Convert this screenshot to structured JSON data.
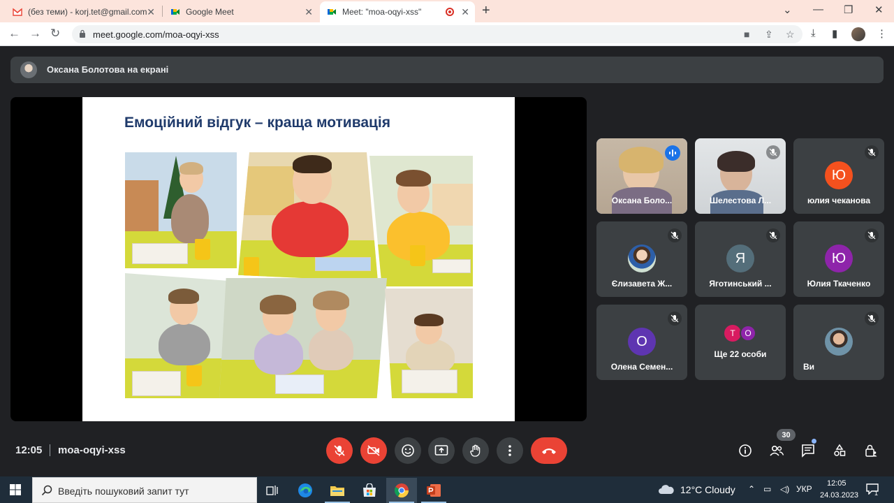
{
  "browser": {
    "tabs": [
      {
        "title": "(без теми) - korj.tet@gmail.com",
        "icon": "gmail-icon"
      },
      {
        "title": "Google Meet",
        "icon": "meet-icon"
      },
      {
        "title": "Meet: \"moa-oqyi-xss\"",
        "icon": "meet-icon",
        "recording": true
      }
    ],
    "url": "meet.google.com/moa-oqyi-xss"
  },
  "meet": {
    "presenting_banner": "Оксана Болотова на екрані",
    "slide": {
      "title": "Емоційний відгук – краща мотивація"
    },
    "participants": [
      {
        "name": "Оксана Боло...",
        "muted": false,
        "speaking": true,
        "type": "video"
      },
      {
        "name": "Шелестова Л...",
        "muted": true,
        "type": "video"
      },
      {
        "name": "юлия чеканова",
        "muted": true,
        "type": "letter",
        "letter": "Ю",
        "color": "#f4511e"
      },
      {
        "name": "Єлизавета Ж...",
        "muted": true,
        "type": "photo"
      },
      {
        "name": "Яготинський ...",
        "muted": true,
        "type": "letter",
        "letter": "Я",
        "color": "#546e7a"
      },
      {
        "name": "Юлия Ткаченко",
        "muted": true,
        "type": "letter",
        "letter": "Ю",
        "color": "#8e24aa"
      },
      {
        "name": "Олена Семен...",
        "muted": true,
        "type": "letter",
        "letter": "О",
        "color": "#5e35b1"
      },
      {
        "name": "Ще 22 особи",
        "type": "more",
        "mini": [
          "Т",
          "О"
        ],
        "mini_colors": [
          "#d81b60",
          "#8e24aa"
        ]
      },
      {
        "name": "Ви",
        "muted": true,
        "type": "photo"
      }
    ],
    "time": "12:05",
    "meeting_code": "moa-oqyi-xss",
    "participant_count": "30"
  },
  "taskbar": {
    "search_placeholder": "Введіть пошуковий запит тут",
    "weather": "12°C  Cloudy",
    "language": "УКР",
    "clock_time": "12:05",
    "clock_date": "24.03.2023",
    "notifications": "1"
  }
}
